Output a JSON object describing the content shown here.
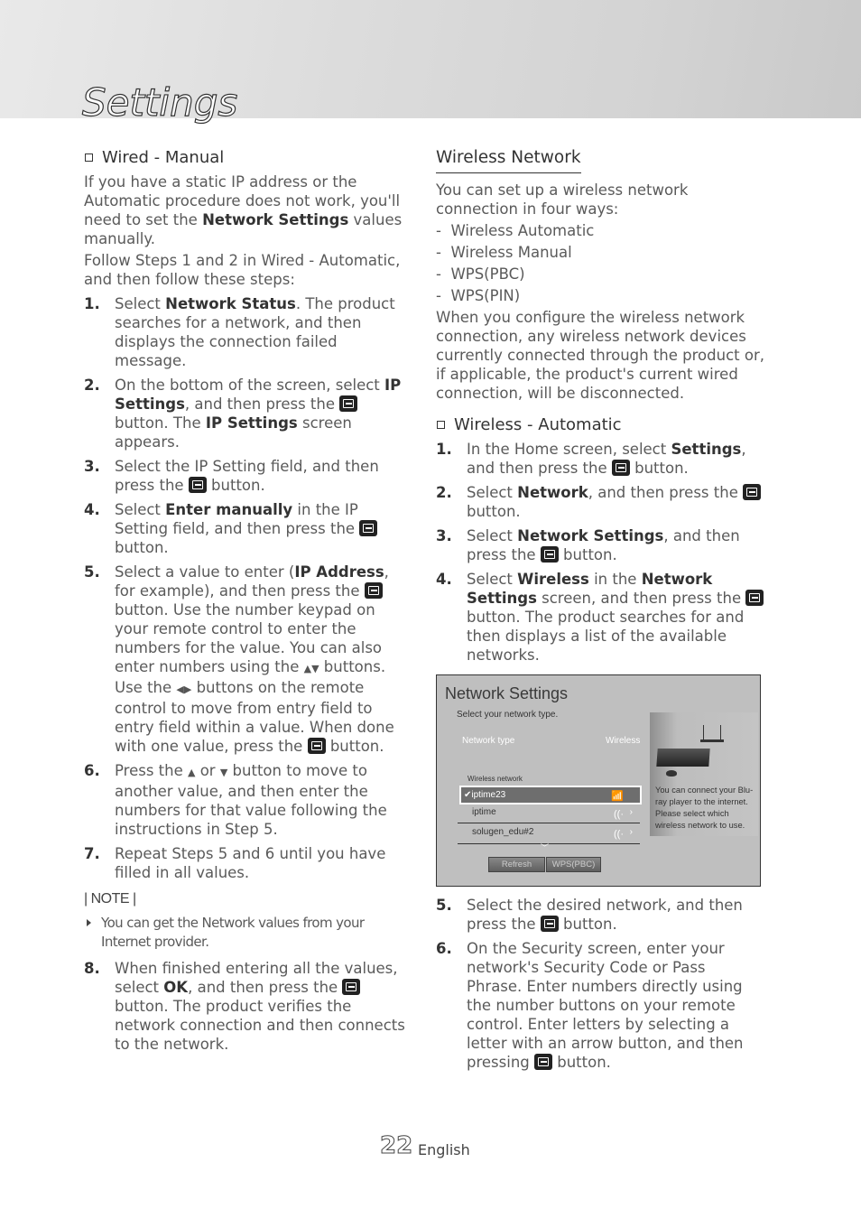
{
  "header": {
    "title": "Settings"
  },
  "left": {
    "subheading": "Wired - Manual",
    "intro": [
      {
        "pre": "If you have a static IP address or the Automatic procedure does not work, you'll need to set the ",
        "bold": "Network Settings",
        "post": " values manually."
      },
      {
        "text": "Follow Steps 1 and 2 in Wired - Automatic, and then follow these steps:"
      }
    ],
    "steps": [
      {
        "num": "1.",
        "parts": [
          "Select ",
          "Network Status",
          ". The product searches for a network, and then displays the connection failed message."
        ]
      },
      {
        "num": "2.",
        "parts": [
          "On the bottom of the screen, select ",
          "IP Settings",
          ", and then press the ",
          "[enter]",
          " button. The ",
          "IP Settings",
          " screen appears."
        ]
      },
      {
        "num": "3.",
        "parts": [
          "Select the IP Setting field, and then press the ",
          "[enter]",
          " button."
        ]
      },
      {
        "num": "4.",
        "parts": [
          "Select ",
          "Enter manually",
          " in the IP Setting field, and then press the ",
          "[enter]",
          " button."
        ]
      },
      {
        "num": "5.",
        "parts": [
          "Select a value to enter (",
          "IP Address",
          ", for example), and then press the ",
          "[enter]",
          " button. Use the number keypad on your remote control to enter the numbers for the value. You can also enter numbers using the ",
          "▲▼",
          " buttons. Use the ",
          "◀▶",
          " buttons on the remote control to move from entry field to entry field within a value. When done with one value, press the ",
          "[enter]",
          " button."
        ]
      },
      {
        "num": "6.",
        "parts": [
          "Press the ",
          "▲",
          " or ",
          "▼",
          " button to move to another value, and then enter the numbers for that value following the instructions in Step 5."
        ]
      },
      {
        "num": "7.",
        "parts": [
          "Repeat Steps 5 and 6 until you have filled in all values."
        ]
      }
    ],
    "note_title": "| NOTE |",
    "note": "You can get the Network values from your Internet provider.",
    "steps2": [
      {
        "num": "8.",
        "parts": [
          "When finished entering all the values, select ",
          "OK",
          ", and then press the ",
          "[enter]",
          " button. The product verifies the network connection and then connects to the network."
        ]
      }
    ]
  },
  "right": {
    "heading": "Wireless Network",
    "intro": "You can set up a wireless network connection in four ways:",
    "ways": [
      "Wireless Automatic",
      "Wireless Manual",
      "WPS(PBC)",
      "WPS(PIN)"
    ],
    "warning": "When you configure the wireless network connection, any wireless network devices currently connected through the product or, if applicable, the product's current wired connection, will be disconnected.",
    "subheading": "Wireless - Automatic",
    "steps": [
      {
        "num": "1.",
        "parts": [
          "In the Home screen, select ",
          "Settings",
          ", and then press the ",
          "[enter]",
          " button."
        ]
      },
      {
        "num": "2.",
        "parts": [
          "Select ",
          "Network",
          ", and then press the ",
          "[enter]",
          " button."
        ]
      },
      {
        "num": "3.",
        "parts": [
          "Select ",
          "Network Settings",
          ", and then press the ",
          "[enter]",
          " button."
        ]
      },
      {
        "num": "4.",
        "parts": [
          "Select ",
          "Wireless",
          " in the ",
          "Network Settings",
          " screen, and then press the ",
          "[enter]",
          " button. The product searches for and then displays a list of the available networks."
        ]
      }
    ],
    "steps2": [
      {
        "num": "5.",
        "parts": [
          "Select the desired network, and then press the ",
          "[enter]",
          " button."
        ]
      },
      {
        "num": "6.",
        "parts": [
          "On the Security screen, enter your network's Security Code or Pass Phrase. Enter numbers directly using the number buttons on your remote control. Enter letters by selecting a letter with an arrow button, and then pressing ",
          "[enter]",
          " button."
        ]
      }
    ]
  },
  "tv_screen": {
    "title": "Network Settings",
    "prompt": "Select your network type.",
    "network_type_label": "Network type",
    "network_type_value": "Wireless",
    "list_label": "Wireless network",
    "networks": [
      {
        "name": "iptime23",
        "selected": true,
        "secured": true
      },
      {
        "name": "iptime",
        "selected": false,
        "secured": false
      },
      {
        "name": "solugen_edu#2",
        "selected": false,
        "secured": true
      }
    ],
    "buttons": [
      "Refresh",
      "WPS(PBC)"
    ],
    "side_text": "You can connect your Blu-ray player to the internet. Please select which wireless network to use."
  },
  "footer": {
    "page_number": "22",
    "language": "English"
  }
}
